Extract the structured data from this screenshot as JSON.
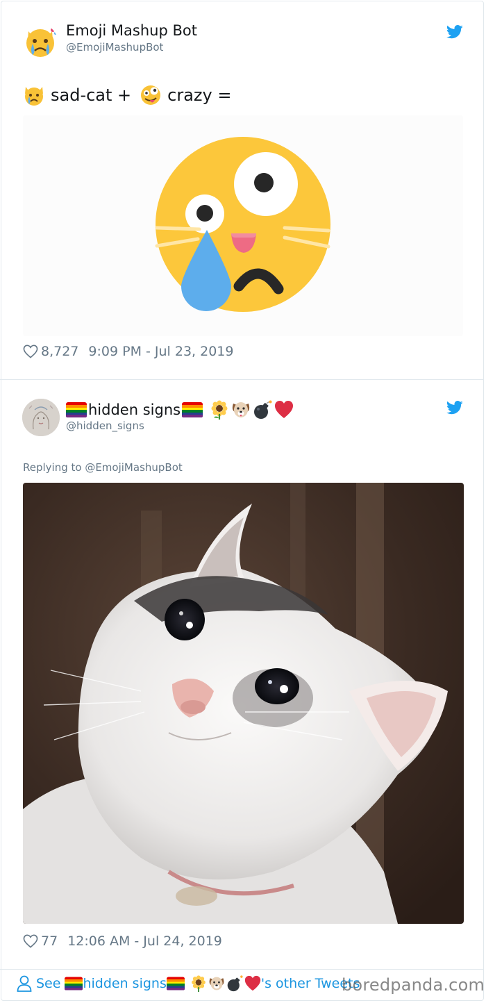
{
  "tweet1": {
    "author": {
      "name": "Emoji Mashup Bot",
      "handle": "@EmojiMashupBot",
      "avatar": "crying-cat-emoji-avatar"
    },
    "text": {
      "part1": "sad-cat +",
      "part2": "crazy ="
    },
    "text_emoji": [
      "crying-cat-face-emoji",
      "zany-face-emoji"
    ],
    "media": "mashup-emoji-image",
    "likes": "8,727",
    "timestamp": "9:09 PM - Jul 23, 2019"
  },
  "tweet2": {
    "author": {
      "name": "hidden signs",
      "handle": "@hidden_signs",
      "avatar": "sketch-avatar"
    },
    "name_emoji": [
      "rainbow-flag-emoji",
      "rainbow-flag-emoji",
      "sunflower-emoji",
      "dog-face-emoji",
      "bomb-emoji",
      "red-heart-emoji"
    ],
    "replying_to": "Replying to @EmojiMashupBot",
    "media": "crying-cat-photo",
    "likes": "77",
    "timestamp": "12:06 AM - Jul 24, 2019"
  },
  "footer": {
    "see_prefix": "See",
    "name": "hidden signs",
    "suffix": "'s other Tweets",
    "icon": "person-icon"
  },
  "watermark": "boredpanda.com",
  "colors": {
    "twitter_blue": "#1da1f2",
    "link_blue": "#1b95e0",
    "muted": "#657786",
    "border": "#e1e8ed",
    "emoji_yellow": "#fcc73b",
    "tear_blue": "#5dadec"
  }
}
